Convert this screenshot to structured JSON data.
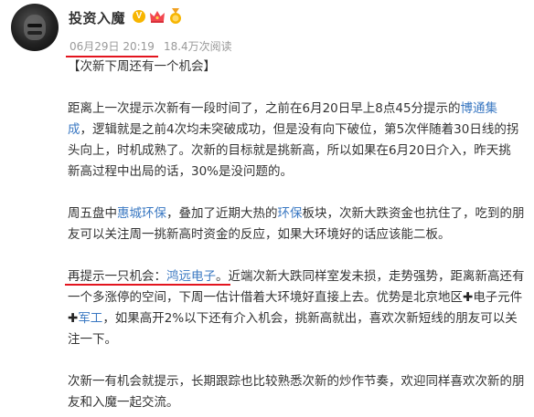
{
  "author": {
    "name": "投资入魔",
    "badges": [
      "verified-v-icon",
      "crown-icon",
      "medal-icon"
    ],
    "verified_glyph": "V"
  },
  "meta": {
    "date": "06月29日 20:19",
    "views": "18.4万次阅读"
  },
  "post": {
    "heading": "【次新下周还有一个机会】",
    "p1": {
      "text_a": "距离上一次提示次新有一段时间了，之前在6月20日早上8点45分提示的",
      "link_a": "博通集成",
      "text_b": "，逻辑就是之前4次均未突破成功，但是没有向下破位，第5次伴随着30日线的拐头向上，时机成熟了。次新的目标就是挑新高，所以如果在6月20日介入，昨天挑新高过程中出局的话，30%是没问题的。"
    },
    "p2": {
      "text_a": "周五盘中",
      "link_a": "惠城环保",
      "text_b": "，叠加了近期大热的",
      "link_b": "环保",
      "text_c": "板块，次新大跌资金也抗住了，吃到的朋友可以关注周一挑新高时资金的反应，如果大环境好的话应该能二板。"
    },
    "p3": {
      "text_a": "再提示一只机会：",
      "link_a": "鸿远电子",
      "text_b": "。近端次新大跌同样室发未损，走势强势，距离新高还有一个多涨停的空间，下周一估计借着大环境好直接上去。优势是北京地区",
      "plus_a": "✚",
      "text_c": "电子元件",
      "plus_b": "✚",
      "link_b": "军工",
      "text_d": "，如果高开2%以下还有介入机会，挑新高就出，喜欢次新短线的朋友可以关注一下。"
    },
    "p4": {
      "text_a": "次新一有机会就提示，长期跟踪也比较熟悉次新的炒作节奏，欢迎同样喜欢次新的朋友和入魔一起交流。"
    }
  },
  "colors": {
    "link": "#3a78c2",
    "annotation_red": "#e3141e",
    "meta_gray": "#999999",
    "text": "#333333"
  }
}
